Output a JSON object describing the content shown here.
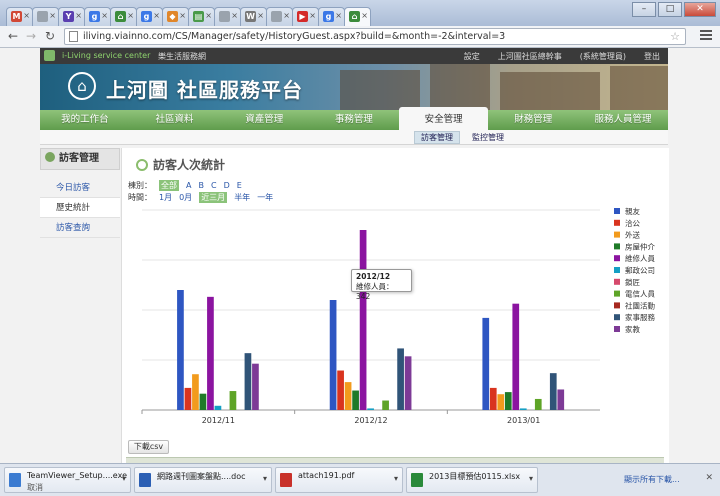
{
  "browser": {
    "tabs": [
      {
        "icon": "gmail-icon",
        "color": "#d14836",
        "glyph": "M",
        "active": false
      },
      {
        "icon": "page-icon",
        "color": "#9aa3ad",
        "glyph": "",
        "active": false
      },
      {
        "icon": "yahoo-icon",
        "color": "#5a3fb0",
        "glyph": "Y",
        "active": false
      },
      {
        "icon": "google-icon",
        "color": "#3b78e7",
        "glyph": "g",
        "active": false
      },
      {
        "icon": "site-icon",
        "color": "#3c8c3c",
        "glyph": "⌂",
        "active": false
      },
      {
        "icon": "google-icon",
        "color": "#3b78e7",
        "glyph": "g",
        "active": false
      },
      {
        "icon": "orange-icon",
        "color": "#e0862a",
        "glyph": "◆",
        "active": false
      },
      {
        "icon": "sheet-icon",
        "color": "#4a9a4a",
        "glyph": "▤",
        "active": false
      },
      {
        "icon": "page-icon",
        "color": "#9aa3ad",
        "glyph": "",
        "active": false
      },
      {
        "icon": "wikipedia-icon",
        "color": "#777777",
        "glyph": "W",
        "active": false
      },
      {
        "icon": "page-icon",
        "color": "#9aa3ad",
        "glyph": "",
        "active": false
      },
      {
        "icon": "youtube-icon",
        "color": "#d42a2a",
        "glyph": "▶",
        "active": false
      },
      {
        "icon": "google-icon",
        "color": "#3b78e7",
        "glyph": "g",
        "active": false
      },
      {
        "icon": "site-icon",
        "color": "#3c8c3c",
        "glyph": "⌂",
        "active": true
      }
    ],
    "url": "iliving.viainno.com/CS/Manager/safety/HistoryGuest.aspx?build=&month=-2&interval=3"
  },
  "site": {
    "breadcrumb": [
      "i-Living service center",
      "樂生活服務網"
    ],
    "top_links": [
      "設定",
      "上河圖社區總幹事",
      "(系統管理員)",
      "登出"
    ],
    "brand": "上河圖 社區服務平台",
    "nav": [
      "我的工作台",
      "社區資料",
      "資產管理",
      "事務管理",
      "安全管理",
      "財務管理",
      "服務人員管理"
    ],
    "nav_active": 4,
    "subnav": [
      "訪客管理",
      "監控管理"
    ]
  },
  "sidebar": {
    "header": "訪客管理",
    "items": [
      "今日訪客",
      "歷史統計",
      "訪客查詢"
    ],
    "active": 1
  },
  "page": {
    "title": "訪客人次統計",
    "category_label": "棟別：",
    "category_options": [
      "全部",
      "A",
      "B",
      "C",
      "D",
      "E"
    ],
    "period_label": "時間：",
    "period_options": [
      "1月",
      "0月",
      "近三月",
      "半年",
      "一年"
    ],
    "csv_button": "下載csv"
  },
  "chart_data": {
    "type": "bar",
    "categories": [
      "2012/11",
      "2012/12",
      "2013/01"
    ],
    "series": [
      {
        "name": "親友",
        "color": "#2e56c2",
        "values": [
          228,
          209,
          175
        ]
      },
      {
        "name": "洽公",
        "color": "#d9341f",
        "values": [
          42,
          75,
          42
        ]
      },
      {
        "name": "外送",
        "color": "#f29b1d",
        "values": [
          68,
          53,
          30
        ]
      },
      {
        "name": "房屋仲介",
        "color": "#1f7a28",
        "values": [
          31,
          37,
          34
        ]
      },
      {
        "name": "維修人員",
        "color": "#8b14a0",
        "values": [
          215,
          342,
          202
        ]
      },
      {
        "name": "郵政公司",
        "color": "#159fc4",
        "values": [
          8,
          3,
          3
        ]
      },
      {
        "name": "鎖匠",
        "color": "#d6496c",
        "values": [
          0,
          0,
          0
        ]
      },
      {
        "name": "電信人員",
        "color": "#5ea427",
        "values": [
          36,
          18,
          21
        ]
      },
      {
        "name": "社團活動",
        "color": "#a6281f",
        "values": [
          0,
          0,
          0
        ]
      },
      {
        "name": "家事服務",
        "color": "#305478",
        "values": [
          108,
          117,
          70
        ]
      },
      {
        "name": "家教",
        "color": "#7d3a96",
        "values": [
          88,
          102,
          39
        ]
      }
    ],
    "ylim": [
      0,
      380
    ],
    "grid": true,
    "legend": "right",
    "tooltip": {
      "category": "2012/12",
      "series": "維修人員",
      "value": 342,
      "label": "維修人員：342"
    }
  },
  "downloads": [
    {
      "name": "TeamViewer_Setup....exe",
      "status": "取消",
      "icon": "exe-icon",
      "color": "#3b7bd1"
    },
    {
      "name": "網路週刊圖案盤點....doc",
      "status": "",
      "icon": "doc-icon",
      "color": "#2b5fb4"
    },
    {
      "name": "attach191.pdf",
      "status": "",
      "icon": "pdf-icon",
      "color": "#c8312a"
    },
    {
      "name": "2013目標預估0115.xlsx",
      "status": "",
      "icon": "xlsx-icon",
      "color": "#2a8a3a"
    }
  ],
  "downloads_show_all": "顯示所有下載..."
}
